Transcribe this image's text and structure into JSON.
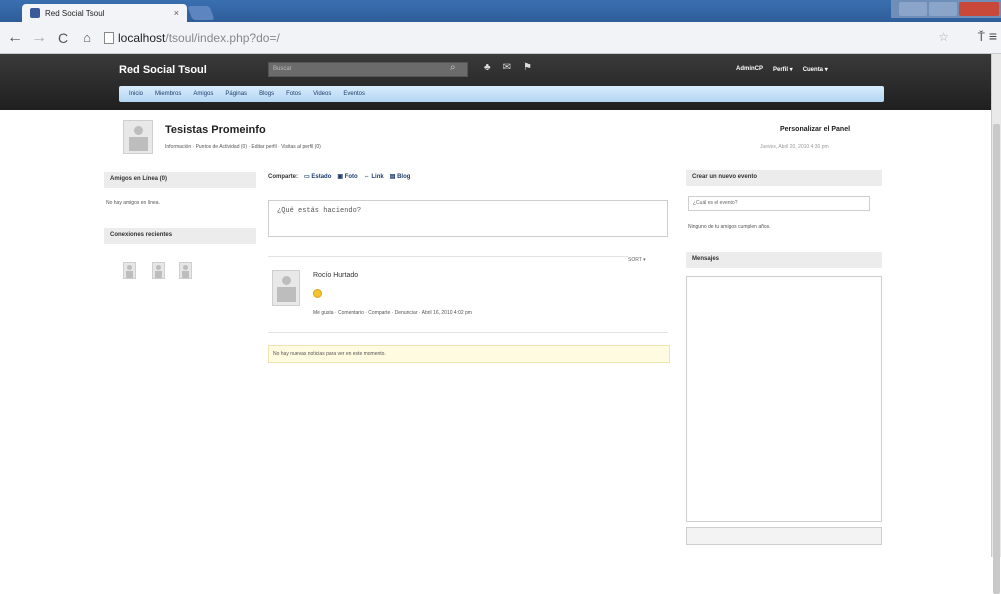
{
  "browser": {
    "tab_title": "Red Social Tsoul",
    "url_host": "localhost",
    "url_path": "/tsoul/index.php?do=/"
  },
  "site": {
    "brand": "Red Social Tsoul",
    "search_placeholder": "Buscar",
    "user_links": [
      "AdminCP",
      "Perfil ▾",
      "Cuenta ▾"
    ],
    "nav": [
      "Inicio",
      "Miembros",
      "Amigos",
      "Páginas",
      "Blogs",
      "Fotos",
      "Videos",
      "Eventos"
    ]
  },
  "profile": {
    "name": "Tesistas Promeinfo",
    "links": "Información · Puntos de Actividad (0) · Editar perfil · Visitas al perfil (0)",
    "customize": "Personalizar el Panel",
    "date": "Jueves, Abril 20, 2010 4:30 pm"
  },
  "left": {
    "online_header": "Amigos en Línea (0)",
    "online_text": "No hay amigos en línea.",
    "recent_header": "Conexiones recientes"
  },
  "center": {
    "share_label": "Comparte:",
    "share_items": [
      "Estado",
      "Foto",
      "Link",
      "Blog"
    ],
    "status_placeholder": "¿Qué estás haciendo?",
    "sort": "SORT ▾",
    "post": {
      "author": "Rocío Hurtado",
      "actions": "Me gusta · Comentario · Comparte · Denunciar · Abril 16, 2010 4:02 pm"
    },
    "notice": "No hay nuevas noticias para ver en este momento."
  },
  "right": {
    "event_header": "Crear un nuevo evento",
    "event_placeholder": "¿Cuál es el evento?",
    "event_text": "Ninguno de tu amigos cumplen años.",
    "messages_header": "Mensajes"
  },
  "colors": {
    "header_bg": "#2a2a2a",
    "nav_band": "#c5e0f7",
    "notice_bg": "#fffbe0"
  }
}
